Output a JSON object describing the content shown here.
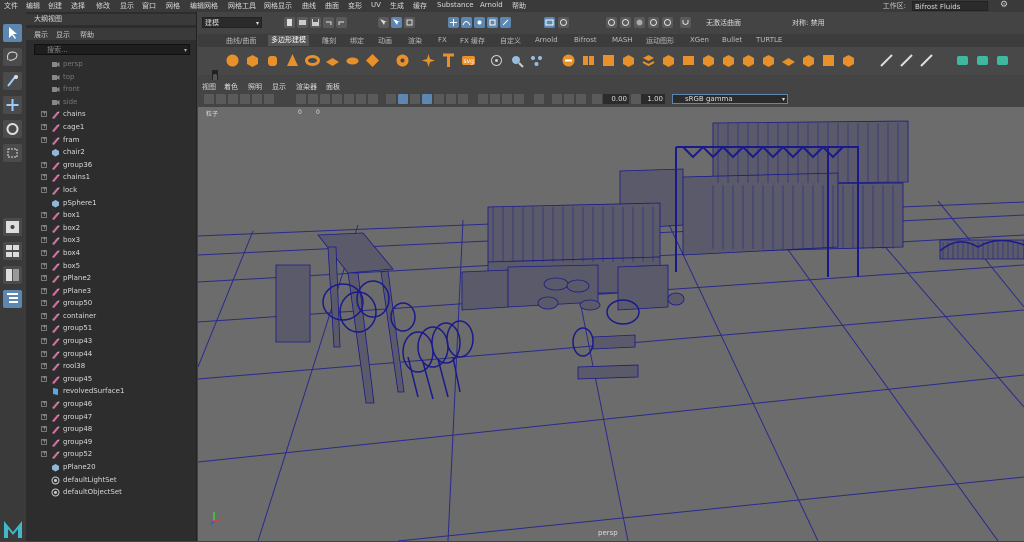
{
  "menubar": {
    "items": [
      "文件",
      "编辑",
      "创建",
      "选择",
      "修改",
      "显示",
      "窗口",
      "网格",
      "编辑网格",
      "网格工具",
      "网格显示",
      "曲线",
      "曲面",
      "变形",
      "UV",
      "生成",
      "缓存",
      "Substance",
      "Arnold",
      "帮助"
    ],
    "workspace_label": "工作区:",
    "workspace_value": "Bifrost Fluids"
  },
  "status_line": {
    "mode": "建模",
    "live_surface": "无激活曲面",
    "symmetry": "对称: 禁用"
  },
  "shelf": {
    "tabs": [
      "曲线/曲面",
      "多边形建模",
      "雕刻",
      "绑定",
      "动画",
      "渲染",
      "FX",
      "FX 缓存",
      "自定义",
      "Arnold",
      "Bifrost",
      "MASH",
      "运动图形",
      "XGen",
      "Bullet",
      "TURTLE"
    ],
    "active_tab": "多边形建模"
  },
  "outliner": {
    "title": "大纲视图",
    "menu": [
      "展示",
      "显示",
      "帮助"
    ],
    "search_placeholder": "搜索...",
    "items": [
      {
        "label": "persp",
        "type": "camera",
        "expandable": false,
        "dim": true
      },
      {
        "label": "top",
        "type": "camera",
        "expandable": false,
        "dim": true
      },
      {
        "label": "front",
        "type": "camera",
        "expandable": false,
        "dim": true
      },
      {
        "label": "side",
        "type": "camera",
        "expandable": false,
        "dim": true
      },
      {
        "label": "chains",
        "type": "group",
        "expandable": true
      },
      {
        "label": "cage1",
        "type": "group",
        "expandable": true
      },
      {
        "label": "fram",
        "type": "group",
        "expandable": true
      },
      {
        "label": "chair2",
        "type": "mesh",
        "expandable": false
      },
      {
        "label": "group36",
        "type": "group",
        "expandable": true
      },
      {
        "label": "chains1",
        "type": "group",
        "expandable": true
      },
      {
        "label": "lock",
        "type": "group",
        "expandable": true
      },
      {
        "label": "pSphere1",
        "type": "mesh",
        "expandable": false
      },
      {
        "label": "box1",
        "type": "group",
        "expandable": true
      },
      {
        "label": "box2",
        "type": "group",
        "expandable": true
      },
      {
        "label": "box3",
        "type": "group",
        "expandable": true
      },
      {
        "label": "box4",
        "type": "group",
        "expandable": true
      },
      {
        "label": "box5",
        "type": "group",
        "expandable": true
      },
      {
        "label": "pPlane2",
        "type": "group",
        "expandable": true
      },
      {
        "label": "pPlane3",
        "type": "group",
        "expandable": true
      },
      {
        "label": "group50",
        "type": "group",
        "expandable": true
      },
      {
        "label": "container",
        "type": "group",
        "expandable": true
      },
      {
        "label": "group51",
        "type": "group",
        "expandable": true
      },
      {
        "label": "group43",
        "type": "group",
        "expandable": true
      },
      {
        "label": "group44",
        "type": "group",
        "expandable": true
      },
      {
        "label": "rool38",
        "type": "group",
        "expandable": true
      },
      {
        "label": "group45",
        "type": "group",
        "expandable": true
      },
      {
        "label": "revolvedSurface1",
        "type": "surface",
        "expandable": false
      },
      {
        "label": "group46",
        "type": "group",
        "expandable": true
      },
      {
        "label": "group47",
        "type": "group",
        "expandable": true
      },
      {
        "label": "group48",
        "type": "group",
        "expandable": true
      },
      {
        "label": "group49",
        "type": "group",
        "expandable": true
      },
      {
        "label": "group52",
        "type": "group",
        "expandable": true
      },
      {
        "label": "pPlane20",
        "type": "mesh",
        "expandable": false
      },
      {
        "label": "defaultLightSet",
        "type": "set",
        "expandable": false
      },
      {
        "label": "defaultObjectSet",
        "type": "set",
        "expandable": false
      }
    ]
  },
  "panel": {
    "menu": [
      "视图",
      "着色",
      "照明",
      "显示",
      "渲染器",
      "面板"
    ],
    "exposure": "0.00",
    "gamma": "1.00",
    "color_space": "sRGB gamma"
  },
  "viewport": {
    "hud_particles_label": "粒子",
    "hud_value_1": "0",
    "hud_value_2": "0",
    "camera_label": "persp"
  },
  "colors": {
    "accent": "#5d86b0",
    "shelf_orange": "#e8902a",
    "wireframe": "#1a1a8a",
    "viewport_bg": "#6c6c6c"
  }
}
